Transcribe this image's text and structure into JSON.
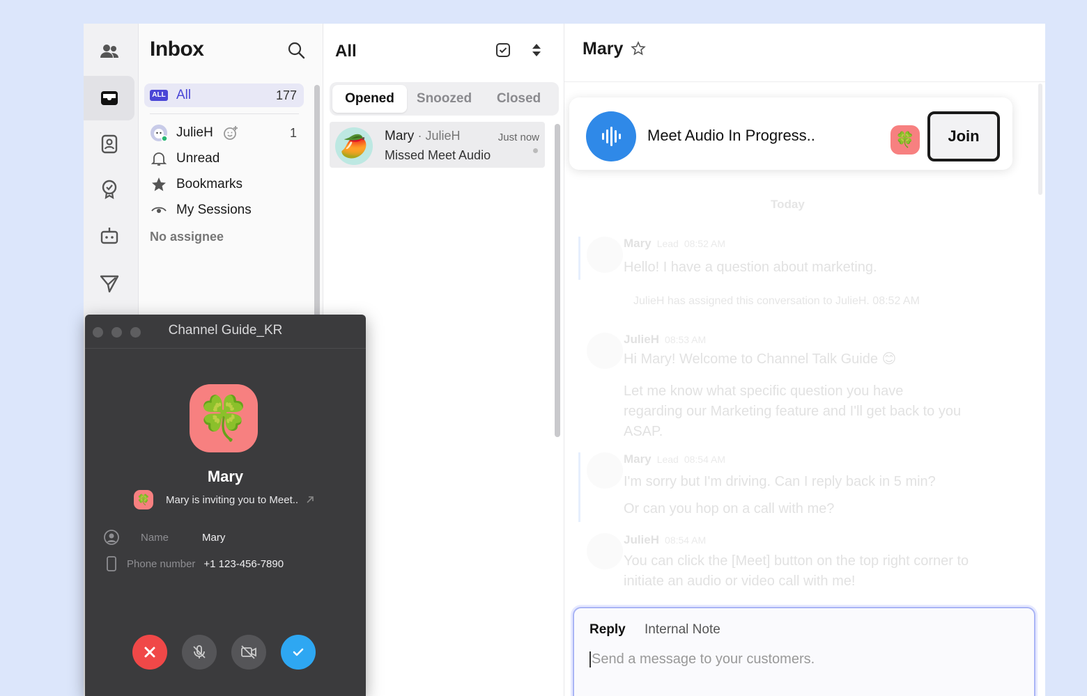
{
  "inbox": {
    "title": "Inbox",
    "items": [
      {
        "label": "All",
        "badge": "ALL",
        "count": "177"
      },
      {
        "label": "JulieH",
        "count": "1"
      },
      {
        "label": "Unread"
      },
      {
        "label": "Bookmarks"
      },
      {
        "label": "My Sessions"
      }
    ],
    "no_assignee": "No assignee"
  },
  "list": {
    "title": "All",
    "tabs": [
      "Opened",
      "Snoozed",
      "Closed"
    ],
    "conversation": {
      "name": "Mary",
      "assignee": "· JulieH",
      "time": "Just now",
      "message": "Missed Meet Audio",
      "avatar_emoji": "🥭"
    }
  },
  "chat": {
    "name": "Mary",
    "meet_text": "Meet Audio In Progress..",
    "join_label": "Join",
    "meet_avatar_emoji": "🍀",
    "today": "Today",
    "messages": [
      {
        "who": "Mary",
        "tag": "Lead",
        "time": "08:52 AM",
        "lines": [
          "Hello! I have a question about marketing."
        ]
      },
      {
        "who": "JulieH",
        "time": "08:53 AM",
        "lines": [
          "Hi Mary! Welcome to Channel Talk Guide 😊",
          "Let me know what specific question you have regarding our Marketing feature and I'll get back to you ASAP."
        ]
      },
      {
        "who": "Mary",
        "tag": "Lead",
        "time": "08:54 AM",
        "lines": [
          "I'm sorry but I'm driving. Can I reply back in 5 min?",
          "Or can you hop on a call with me?"
        ]
      },
      {
        "who": "JulieH",
        "time": "08:54 AM",
        "lines": [
          "You can click the [Meet] button on the top right corner to initiate an audio or video call with me!"
        ]
      }
    ],
    "system_note": "JulieH has assigned this conversation to JulieH.",
    "system_time": "08:52 AM",
    "reply_tab": "Reply",
    "note_tab": "Internal Note",
    "placeholder": "Send a message to your customers."
  },
  "popup": {
    "title": "Channel Guide_KR",
    "avatar_emoji": "🍀",
    "name": "Mary",
    "invite": "Mary is inviting you to Meet..",
    "name_label": "Name",
    "name_value": "Mary",
    "phone_label": "Phone number",
    "phone_value": "+1 123-456-7890"
  },
  "colors": {
    "accent": "#4a46d6",
    "meet_blue": "#2f89e8",
    "decline_red": "#f04848",
    "accept_blue": "#2ea7f2"
  }
}
